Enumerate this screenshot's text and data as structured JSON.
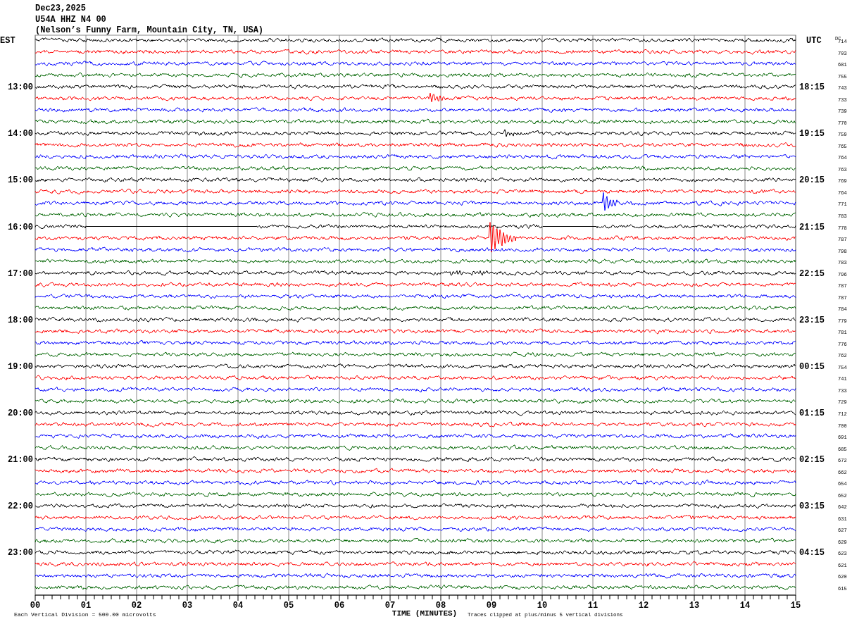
{
  "header": {
    "date": "Dec23,2025",
    "station": "U54A HHZ N4 00",
    "location": "(Nelson’s Funny Farm, Mountain City, TN, USA)"
  },
  "left_zone": "EST",
  "right_zone": "UTC",
  "dc_label": "DC",
  "traces": [
    {
      "color": "#000000",
      "dc": "714"
    },
    {
      "color": "#ff0000",
      "dc": "703"
    },
    {
      "color": "#0000ff",
      "dc": "681"
    },
    {
      "color": "#006400",
      "dc": "755"
    },
    {
      "color": "#000000",
      "dc": "743",
      "est": "13:00",
      "utc": "18:15"
    },
    {
      "color": "#ff0000",
      "dc": "733"
    },
    {
      "color": "#0000ff",
      "dc": "739"
    },
    {
      "color": "#006400",
      "dc": "770"
    },
    {
      "color": "#000000",
      "dc": "759",
      "est": "14:00",
      "utc": "19:15"
    },
    {
      "color": "#ff0000",
      "dc": "765"
    },
    {
      "color": "#0000ff",
      "dc": "764"
    },
    {
      "color": "#006400",
      "dc": "763"
    },
    {
      "color": "#000000",
      "dc": "769",
      "est": "15:00",
      "utc": "20:15"
    },
    {
      "color": "#ff0000",
      "dc": "764"
    },
    {
      "color": "#0000ff",
      "dc": "771"
    },
    {
      "color": "#006400",
      "dc": "783"
    },
    {
      "color": "#000000",
      "dc": "778",
      "est": "16:00",
      "utc": "21:15"
    },
    {
      "color": "#ff0000",
      "dc": "787"
    },
    {
      "color": "#0000ff",
      "dc": "798"
    },
    {
      "color": "#006400",
      "dc": "783"
    },
    {
      "color": "#000000",
      "dc": "796",
      "est": "17:00",
      "utc": "22:15"
    },
    {
      "color": "#ff0000",
      "dc": "787"
    },
    {
      "color": "#0000ff",
      "dc": "787"
    },
    {
      "color": "#006400",
      "dc": "784"
    },
    {
      "color": "#000000",
      "dc": "779",
      "est": "18:00",
      "utc": "23:15"
    },
    {
      "color": "#ff0000",
      "dc": "781"
    },
    {
      "color": "#0000ff",
      "dc": "776"
    },
    {
      "color": "#006400",
      "dc": "762"
    },
    {
      "color": "#000000",
      "dc": "754",
      "est": "19:00",
      "utc": "00:15"
    },
    {
      "color": "#ff0000",
      "dc": "741"
    },
    {
      "color": "#0000ff",
      "dc": "733"
    },
    {
      "color": "#006400",
      "dc": "729"
    },
    {
      "color": "#000000",
      "dc": "712",
      "est": "20:00",
      "utc": "01:15"
    },
    {
      "color": "#ff0000",
      "dc": "700"
    },
    {
      "color": "#0000ff",
      "dc": "691"
    },
    {
      "color": "#006400",
      "dc": "685"
    },
    {
      "color": "#000000",
      "dc": "672",
      "est": "21:00",
      "utc": "02:15"
    },
    {
      "color": "#ff0000",
      "dc": "662"
    },
    {
      "color": "#0000ff",
      "dc": "654"
    },
    {
      "color": "#006400",
      "dc": "652"
    },
    {
      "color": "#000000",
      "dc": "642",
      "est": "22:00",
      "utc": "03:15"
    },
    {
      "color": "#ff0000",
      "dc": "631"
    },
    {
      "color": "#0000ff",
      "dc": "627"
    },
    {
      "color": "#006400",
      "dc": "629"
    },
    {
      "color": "#000000",
      "dc": "623",
      "est": "23:00",
      "utc": "04:15"
    },
    {
      "color": "#ff0000",
      "dc": "621"
    },
    {
      "color": "#0000ff",
      "dc": "620"
    },
    {
      "color": "#006400",
      "dc": "615"
    }
  ],
  "x_axis": {
    "ticks": [
      "00",
      "01",
      "02",
      "03",
      "04",
      "05",
      "06",
      "07",
      "08",
      "09",
      "10",
      "11",
      "12",
      "13",
      "14",
      "15"
    ],
    "title": "TIME (MINUTES)"
  },
  "footer": {
    "scale_note": "Each Vertical Division =  500.00 microvolts",
    "clip_note": "Traces clipped at plus/minus 5 vertical divisions"
  }
}
